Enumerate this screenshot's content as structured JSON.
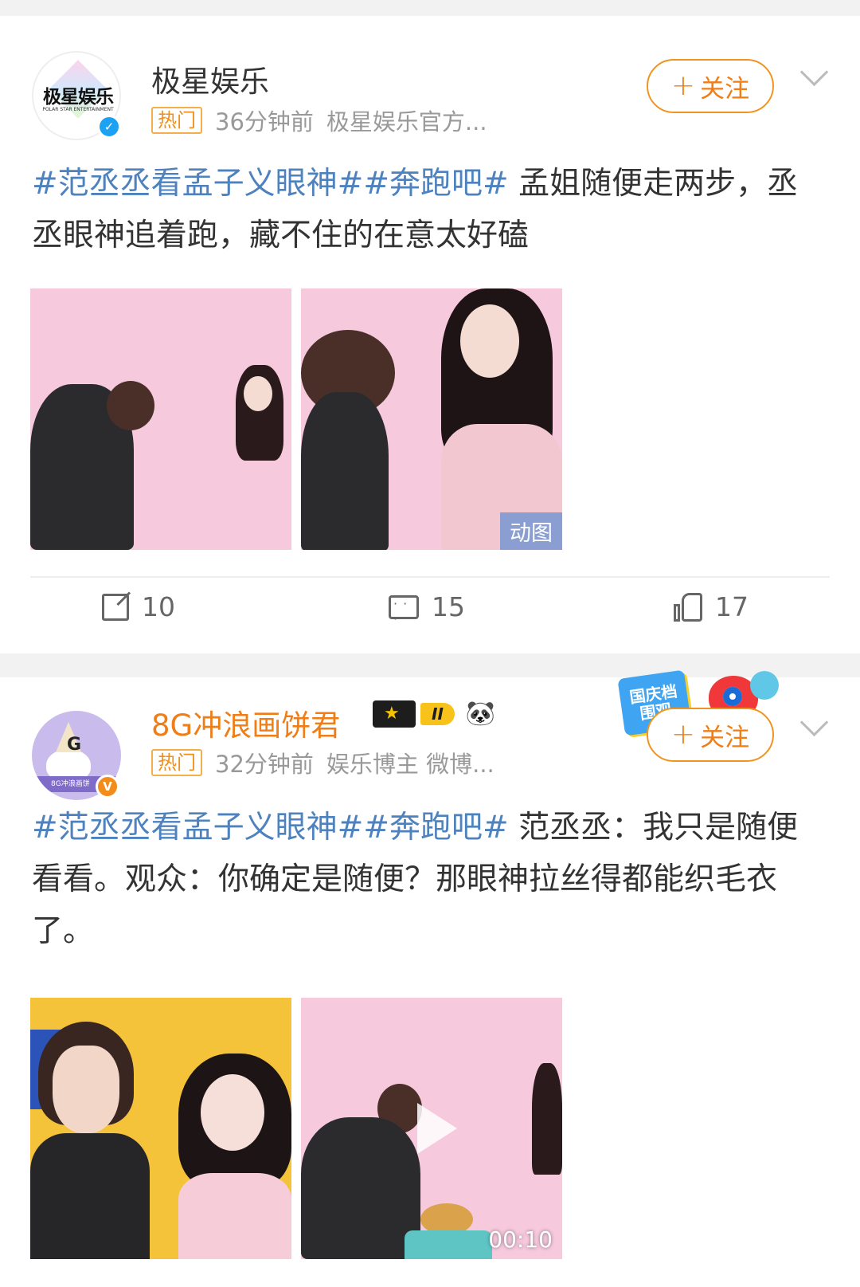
{
  "posts": [
    {
      "author": "极星娱乐",
      "avatar_text": "极星娱乐",
      "avatar_subtext": "POLAR STAR ENTERTAINMENT",
      "badge": "热门",
      "time": "36分钟前",
      "source": "极星娱乐官方...",
      "follow_label": "关注",
      "follow_plus": "+",
      "verify": "✓",
      "content": {
        "tag1": "#范丞丞看孟子义眼神#",
        "tag2": "#奔跑吧#",
        "text": " 孟姐随便走两步，丞丞眼神追着跑，藏不住的在意太好磕"
      },
      "media": [
        {
          "type": "image",
          "badge": ""
        },
        {
          "type": "image",
          "badge": "动图"
        }
      ],
      "actions": {
        "shares": "10",
        "comments": "15",
        "likes": "17"
      }
    },
    {
      "author": "8G冲浪画饼君",
      "avatar_text": "G",
      "avatar_subtext": "8G冲浪画饼",
      "level": "II",
      "badge": "热门",
      "time": "32分钟前",
      "source": "娱乐博主 微博...",
      "follow_label": "关注",
      "follow_plus": "+",
      "verify": "V",
      "sticker_text": "国庆档 围观",
      "content": {
        "tag1": "#范丞丞看孟子义眼神#",
        "tag2": "#奔跑吧#",
        "text": " 范丞丞：我只是随便看看。观众：你确定是随便？那眼神拉丝得都能织毛衣了。"
      },
      "media": [
        {
          "type": "image"
        },
        {
          "type": "video",
          "duration": "00:10"
        }
      ]
    }
  ],
  "icons": {
    "verify_blue": "#1da1f2",
    "verify_orange": "#f28c1b",
    "accent": "#f07d15",
    "link": "#4d82bf"
  }
}
